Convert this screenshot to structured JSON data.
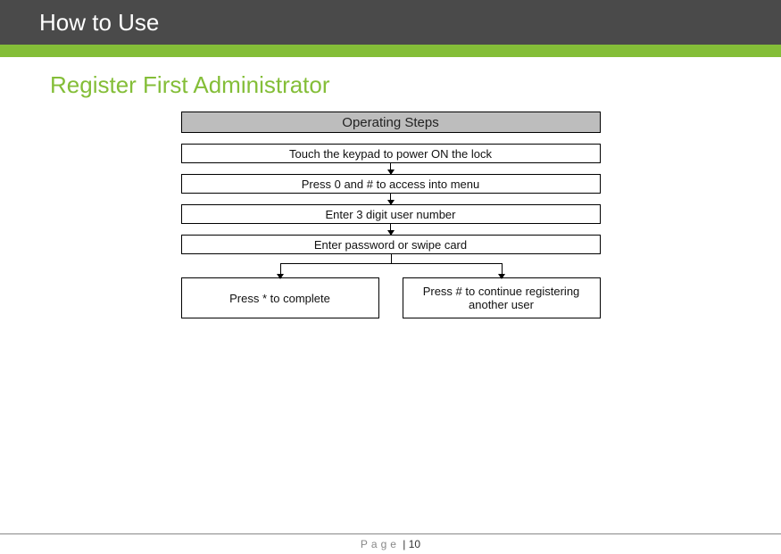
{
  "header": {
    "title": "How to Use"
  },
  "section": {
    "title": "Register First Administrator"
  },
  "diagram": {
    "ops_header": "Operating Steps",
    "steps": [
      "Touch the keypad to power ON the lock",
      "Press  0 and  # to access into menu",
      "Enter 3 digit user number",
      "Enter password or swipe card"
    ],
    "branch_left": "Press  *  to complete",
    "branch_right": "Press # to continue registering another user"
  },
  "footer": {
    "label": "Page",
    "sep": " | ",
    "number": "10"
  }
}
